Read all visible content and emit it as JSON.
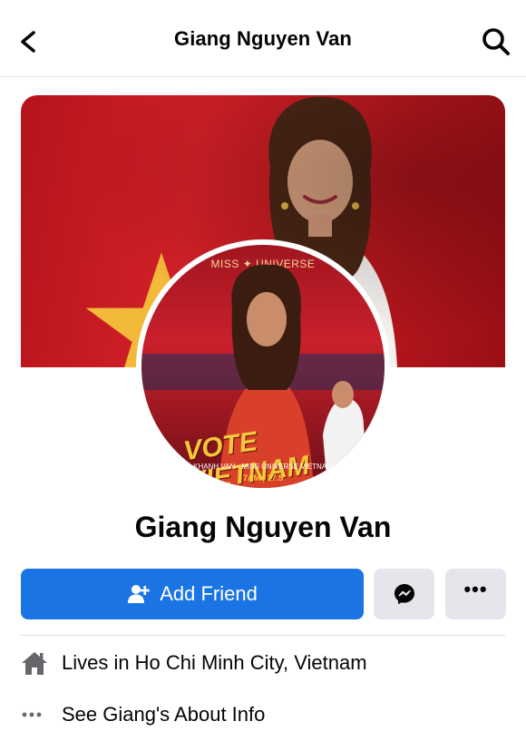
{
  "header": {
    "title": "Giang Nguyen Van"
  },
  "cover": {
    "colors": {
      "flag_red": "#c41a20",
      "star_yellow": "#f6c73b"
    }
  },
  "avatar": {
    "top_text": "MISS ✦ UNIVERSE",
    "vote_text": "VOTE VIETNAM",
    "sub_text": "KHANH VAN - MISS UNIVERSE VIETNAM",
    "date_text": "7AM | 17.5"
  },
  "profile": {
    "name": "Giang Nguyen Van"
  },
  "actions": {
    "add_friend_label": "Add Friend",
    "accent_color": "#1b74e4",
    "messenger_icon": "messenger-icon",
    "more_icon": "more-icon"
  },
  "info": {
    "lives_prefix": "Lives in",
    "lives_city": "Ho Chi Minh City, Vietnam",
    "about_label": "See Giang's About Info"
  }
}
